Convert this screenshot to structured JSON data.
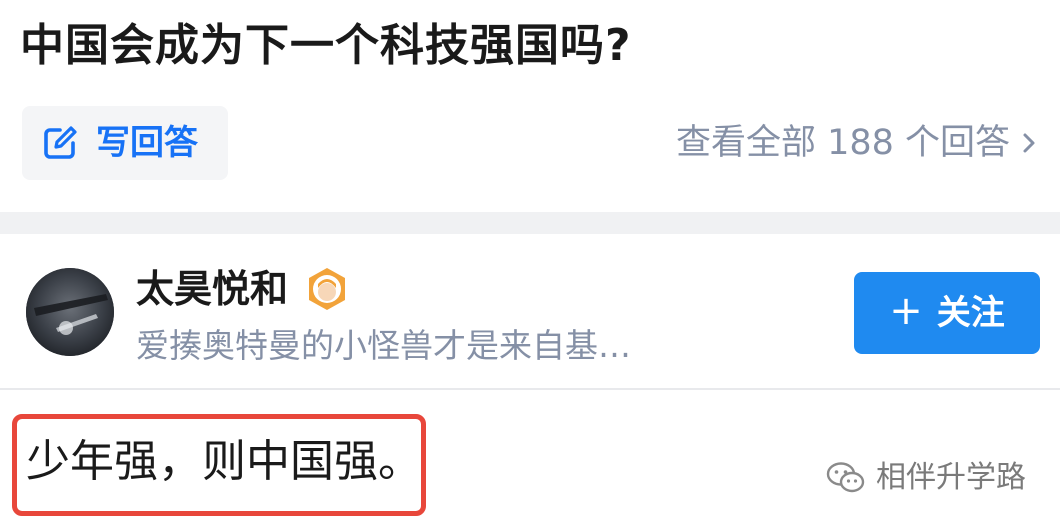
{
  "question": {
    "title": "中国会成为下一个科技强国吗?"
  },
  "actions": {
    "write_answer_label": "写回答",
    "view_all_label": "查看全部 188 个回答"
  },
  "author": {
    "name": "太昊悦和",
    "bio": "爱揍奥特曼的小怪兽才是来自基…",
    "follow_label": "关注"
  },
  "answer": {
    "text": "少年强，则中国强。"
  },
  "watermark": {
    "text": "相伴升学路"
  },
  "icons": {
    "write": "edit-pencil-icon",
    "chevron": "chevron-right-icon",
    "badge": "user-badge-icon",
    "plus": "plus-icon",
    "watermark": "wechat-icon"
  },
  "colors": {
    "accent_blue": "#1772f6",
    "follow_button": "#1f8af0",
    "muted_text": "#8590a6",
    "annotation_red": "#e8473b"
  }
}
